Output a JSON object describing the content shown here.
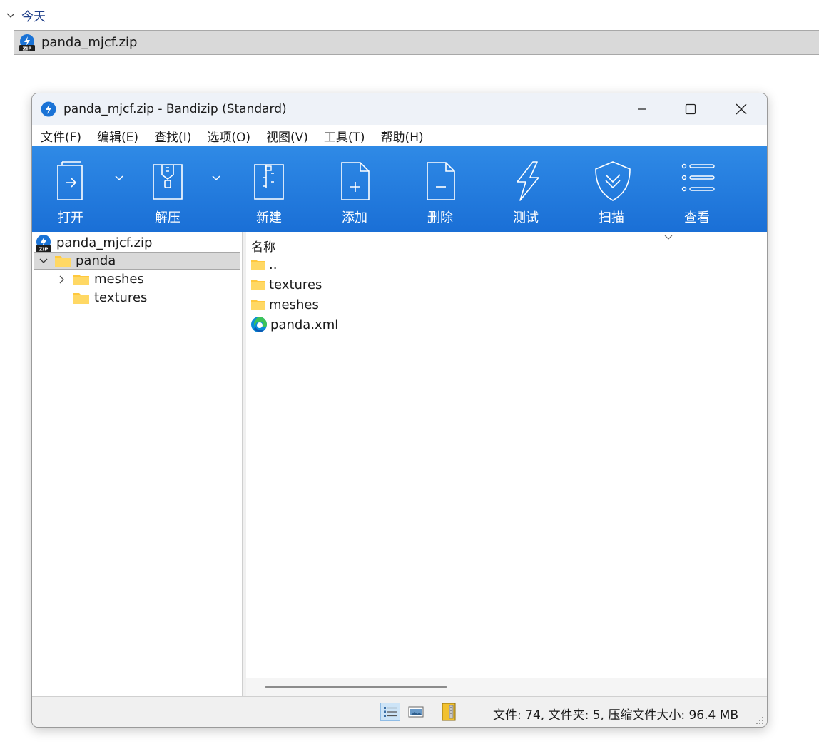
{
  "explorer": {
    "group_label": "今天",
    "file_name": "panda_mjcf.zip"
  },
  "window": {
    "title": "panda_mjcf.zip - Bandizip (Standard)",
    "menu": [
      "文件(F)",
      "编辑(E)",
      "查找(I)",
      "选项(O)",
      "视图(V)",
      "工具(T)",
      "帮助(H)"
    ],
    "toolbar": {
      "open": "打开",
      "extract": "解压",
      "new": "新建",
      "add": "添加",
      "delete": "删除",
      "test": "测试",
      "scan": "扫描",
      "view": "查看"
    },
    "tree": {
      "root": "panda_mjcf.zip",
      "selected": "panda",
      "children": [
        "meshes",
        "textures"
      ]
    },
    "list": {
      "column_name": "名称",
      "items": [
        "..",
        "textures",
        "meshes",
        "panda.xml"
      ]
    },
    "status": "文件: 74, 文件夹: 5, 压缩文件大小: 96.4 MB"
  },
  "colors": {
    "toolbar_top": "#2f8ae6",
    "toolbar_bottom": "#1a6fd6",
    "selection": "#d9d9d9",
    "folder": "#ffc83d",
    "accent_text": "#1f3f8a"
  }
}
